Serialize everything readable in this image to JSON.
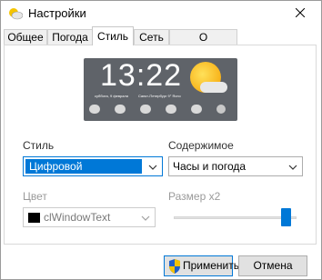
{
  "window": {
    "title": "Настройки"
  },
  "tabs": [
    {
      "label": "Общее",
      "active": false
    },
    {
      "label": "Погода",
      "active": false
    },
    {
      "label": "Стиль",
      "active": true
    },
    {
      "label": "Сеть",
      "active": false
    },
    {
      "label": "О программе",
      "active": false
    }
  ],
  "preview": {
    "time": "13:22",
    "date": "суббота, 9 февраля",
    "city": "Санкт-Петербург 9° Ясно",
    "weather_icon": "sun-cloud-icon"
  },
  "style": {
    "label": "Стиль",
    "value": "Цифровой"
  },
  "content": {
    "label": "Содержимое",
    "value": "Часы и погода"
  },
  "color": {
    "label": "Цвет",
    "value": "clWindowText",
    "swatch": "#000000"
  },
  "size": {
    "label": "Размер x2",
    "level": 1.0
  },
  "buttons": {
    "apply": "Применить",
    "cancel": "Отмена"
  },
  "colors": {
    "accent": "#0078d7",
    "shield_blue": "#1f5fc8",
    "shield_yellow": "#f2c200"
  }
}
